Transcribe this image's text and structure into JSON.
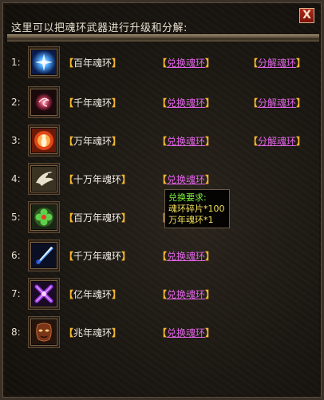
{
  "window": {
    "title": "这里可以把魂环武器进行升级和分解:",
    "close_label": "X"
  },
  "actions": {
    "exchange_label": "兑换魂环",
    "decompose_label": "分解魂环",
    "bracket_open": "【",
    "bracket_close": "】"
  },
  "rings": [
    {
      "index": "1:",
      "name": "百年魂环",
      "icon": "blue-spark-icon",
      "has_decompose": true
    },
    {
      "index": "2:",
      "name": "千年魂环",
      "icon": "red-swirl-icon",
      "has_decompose": true
    },
    {
      "index": "3:",
      "name": "万年魂环",
      "icon": "flame-figure-icon",
      "has_decompose": true
    },
    {
      "index": "4:",
      "name": "十万年魂环",
      "icon": "white-bird-icon",
      "has_decompose": false
    },
    {
      "index": "5:",
      "name": "百万年魂环",
      "icon": "green-clover-icon",
      "has_decompose": false
    },
    {
      "index": "6:",
      "name": "千万年魂环",
      "icon": "blue-blade-icon",
      "has_decompose": false
    },
    {
      "index": "7:",
      "name": "亿年魂环",
      "icon": "purple-cross-icon",
      "has_decompose": false
    },
    {
      "index": "8:",
      "name": "兆年魂环",
      "icon": "brown-mask-icon",
      "has_decompose": false
    }
  ],
  "tooltip": {
    "title": "兑换要求:",
    "line1": "魂环碎片*100",
    "line2": "万年魂环*1"
  },
  "colors": {
    "link": "#e064e6",
    "bracket": "#f3b630",
    "tooltip_title": "#7cf23a",
    "tooltip_text": "#f3e05a"
  }
}
